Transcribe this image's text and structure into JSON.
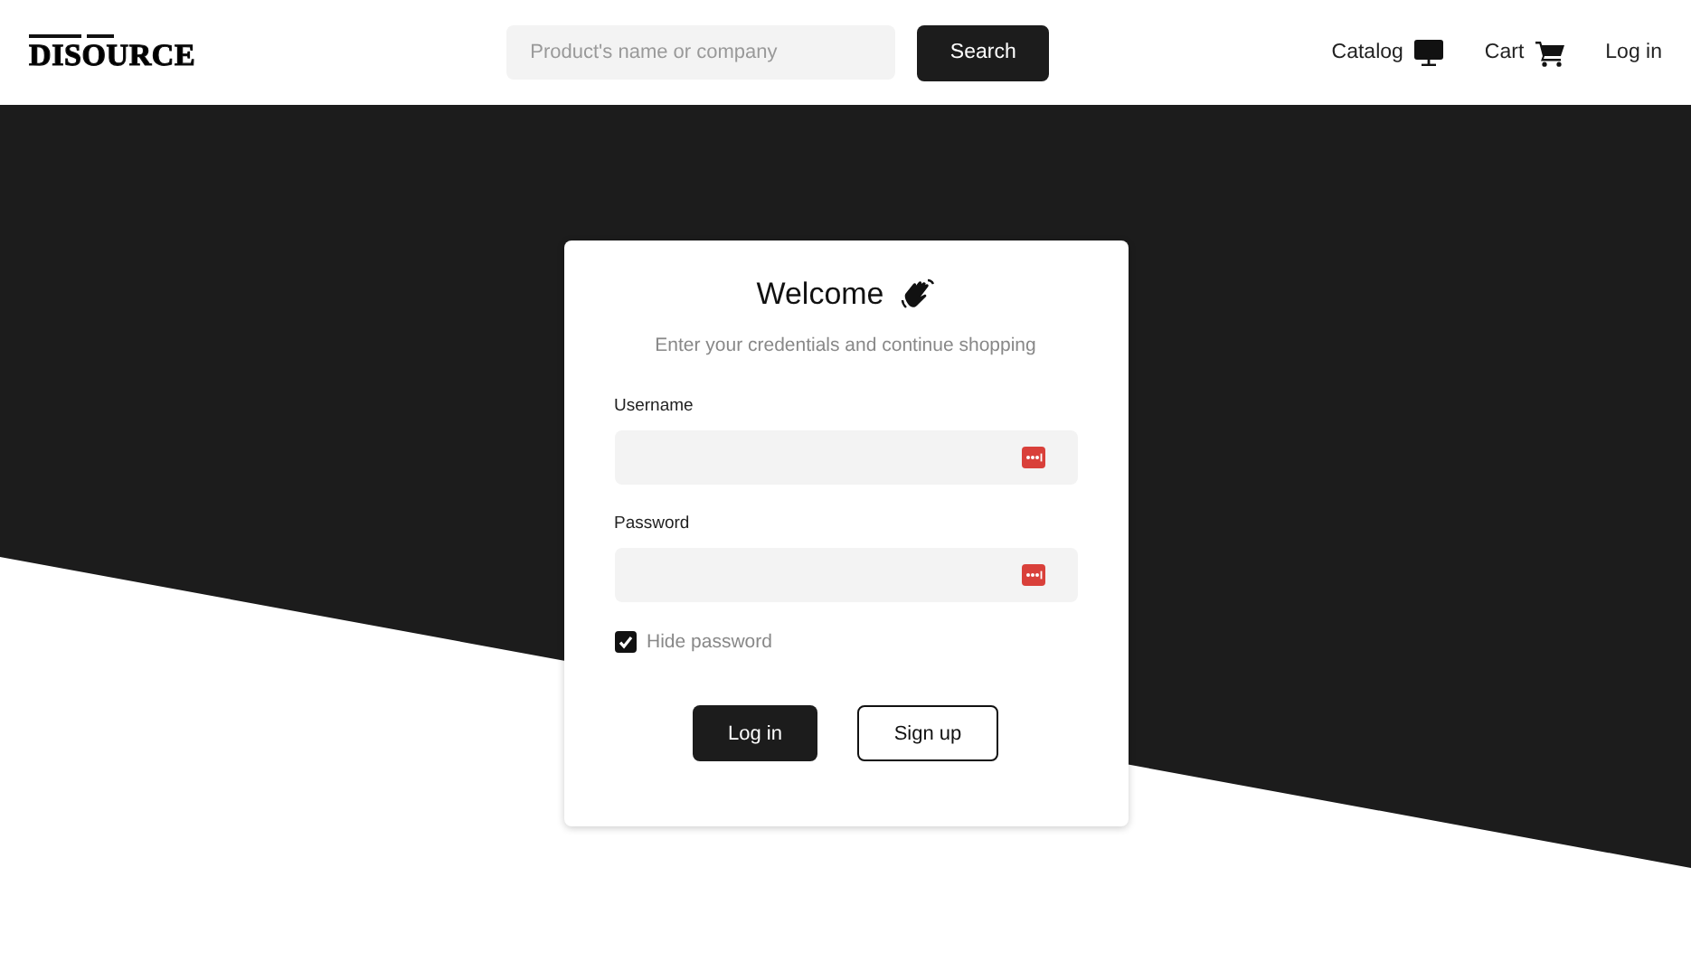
{
  "header": {
    "logo": "DISOURCE",
    "search": {
      "placeholder": "Product's name or company",
      "button": "Search"
    },
    "nav": [
      {
        "label": "Catalog",
        "kind": "monitor"
      },
      {
        "label": "Cart",
        "kind": "cart"
      },
      {
        "label": "Log in",
        "kind": "text"
      }
    ]
  },
  "login": {
    "title": "Welcome",
    "subtitle": "Enter your credentials and continue shopping",
    "fields": [
      {
        "label": "Username"
      },
      {
        "label": "Password"
      }
    ],
    "hide_password": {
      "label": "Hide password",
      "checked": true
    },
    "buttons": [
      {
        "label": "Log in",
        "kind": "primary"
      },
      {
        "label": "Sign up",
        "kind": "secondary"
      }
    ]
  }
}
